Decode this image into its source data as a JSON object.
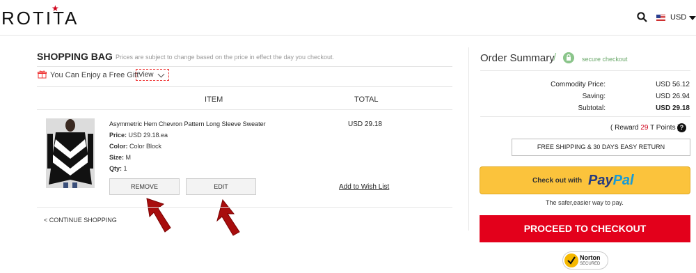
{
  "header": {
    "logo": "ROTITA",
    "currency": "USD",
    "icons": {
      "search": "search-icon",
      "flag": "us-flag-icon",
      "dropdown": "caret-down-icon"
    }
  },
  "bag": {
    "title": "SHOPPING BAG",
    "note": "Prices are subject to change based on the price in effect the day you checkout.",
    "gift_text": "You Can Enjoy a Free Gift",
    "view_label": "View",
    "columns": {
      "item": "ITEM",
      "total": "TOTAL"
    },
    "item": {
      "name": "Asymmetric Hem Chevron Pattern Long Sleeve Sweater",
      "price_label": "Price:",
      "price_value": "USD 29.18.ea",
      "color_label": "Color:",
      "color_value": "Color Block",
      "size_label": "Size:",
      "size_value": "M",
      "qty_label": "Qty:",
      "qty_value": "1",
      "total": "USD 29.18"
    },
    "buttons": {
      "remove": "REMOVE",
      "edit": "EDIT",
      "wishlist": "Add to Wish List"
    },
    "continue": "< CONTINUE SHOPPING"
  },
  "summary": {
    "title": "Order Summary",
    "slash": "/",
    "secure": "secure checkout",
    "rows": [
      {
        "label": "Commodity Price:",
        "value": "USD 56.12"
      },
      {
        "label": "Saving:",
        "value": "USD 26.94"
      },
      {
        "label": "Subtotal:",
        "value": "USD 29.18"
      }
    ],
    "reward_prefix": "( Reward ",
    "reward_points": "29",
    "reward_suffix": " T Points )",
    "question_mark": "?",
    "shipping": "FREE SHIPPING & 30 DAYS EASY RETURN",
    "paypal_prefix": "Check out with",
    "paypal_brand_1": "Pay",
    "paypal_brand_2": "Pal",
    "safer": "The safer,easier way to pay.",
    "checkout": "PROCEED TO CHECKOUT",
    "norton_1": "Norton",
    "norton_2": "SECURED"
  },
  "colors": {
    "accent": "#e3001b",
    "paypal_yellow": "#fbc33c",
    "secure_green": "#8bc58b"
  }
}
